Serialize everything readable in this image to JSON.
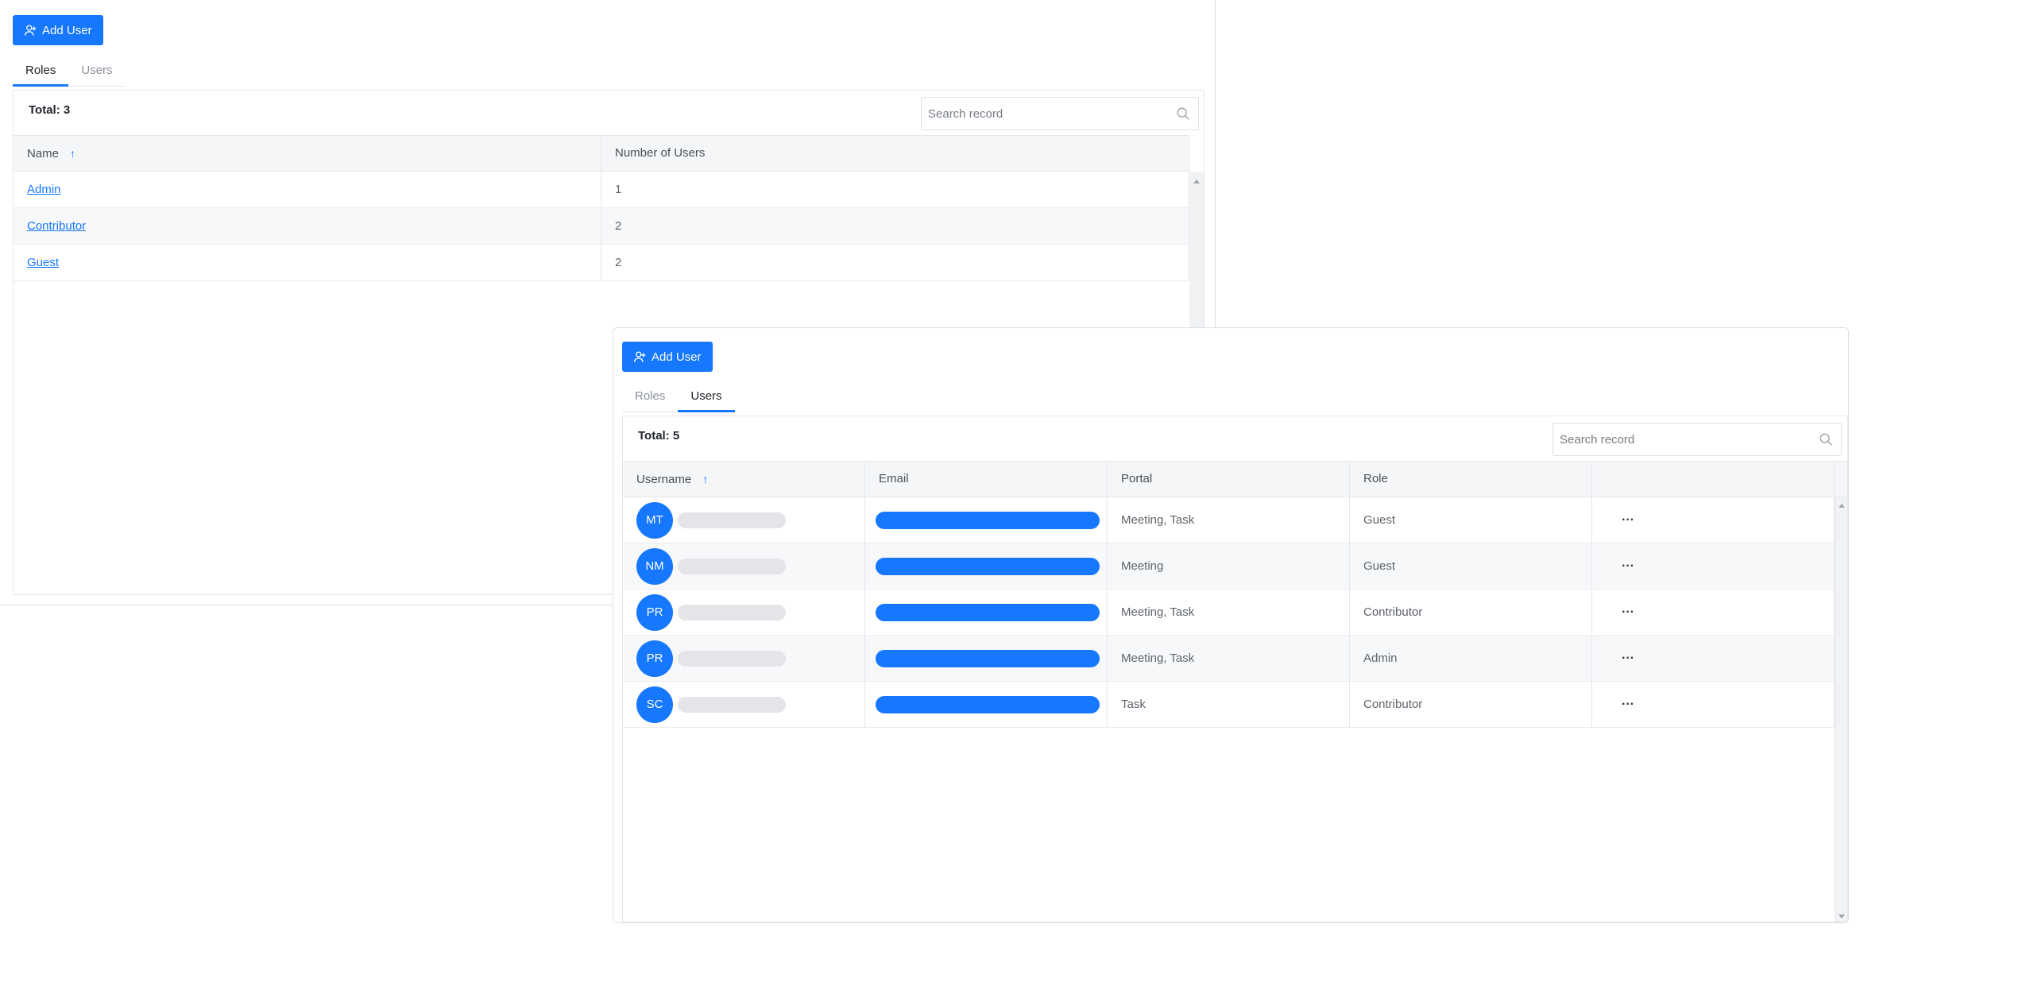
{
  "roles_panel": {
    "add_button_label": "Add User",
    "tabs": [
      {
        "label": "Roles",
        "active": true
      },
      {
        "label": "Users",
        "active": false
      }
    ],
    "total_label": "Total: 3",
    "search_placeholder": "Search record",
    "columns": [
      "Name",
      "Number of Users"
    ],
    "sort_indicator": "↑",
    "rows": [
      {
        "name": "Admin",
        "count": "1"
      },
      {
        "name": "Contributor",
        "count": "2"
      },
      {
        "name": "Guest",
        "count": "2"
      }
    ]
  },
  "users_panel": {
    "add_button_label": "Add User",
    "tabs": [
      {
        "label": "Roles",
        "active": false
      },
      {
        "label": "Users",
        "active": true
      }
    ],
    "total_label": "Total: 5",
    "search_placeholder": "Search record",
    "columns": [
      "Username",
      "Email",
      "Portal",
      "Role",
      ""
    ],
    "sort_indicator": "↑",
    "more_label": "···",
    "rows": [
      {
        "initials": "MT",
        "portal": "Meeting, Task",
        "role": "Guest"
      },
      {
        "initials": "NM",
        "portal": "Meeting",
        "role": "Guest"
      },
      {
        "initials": "PR",
        "portal": "Meeting, Task",
        "role": "Contributor"
      },
      {
        "initials": "PR",
        "portal": "Meeting, Task",
        "role": "Admin"
      },
      {
        "initials": "SC",
        "portal": "Task",
        "role": "Contributor"
      }
    ]
  },
  "colors": {
    "accent": "#1677ff",
    "header_bg": "#f5f6f8",
    "placeholder_bar": "#e3e5e9"
  }
}
